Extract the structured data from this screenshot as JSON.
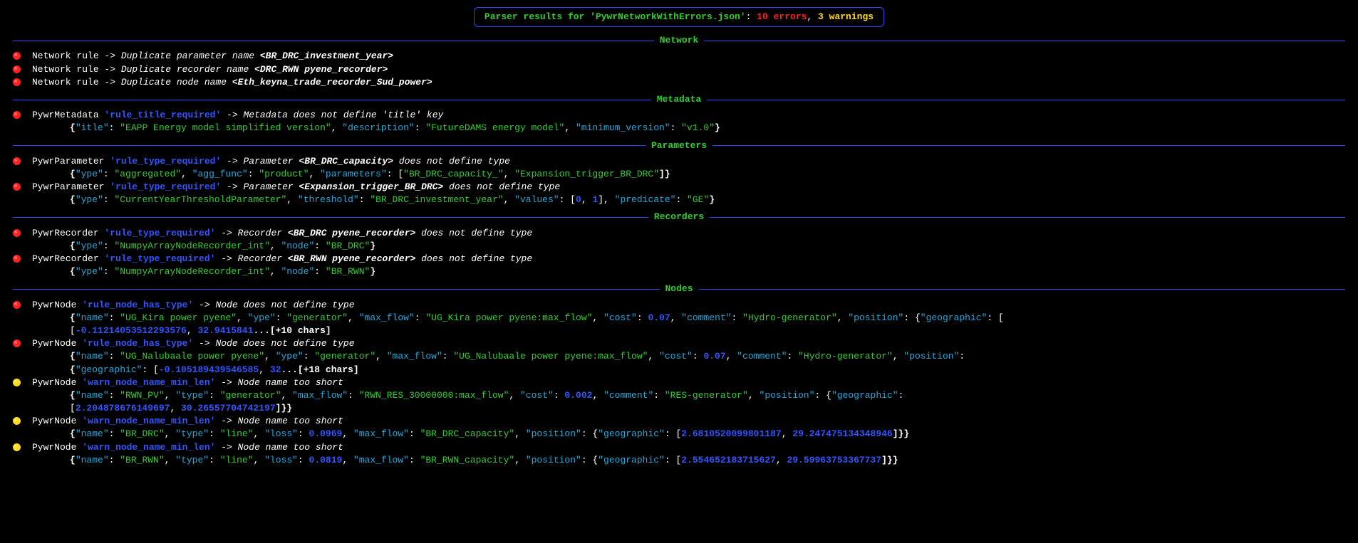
{
  "header": {
    "prefix": "Parser results for ",
    "filename": "'PywrNetworkWithErrors.json'",
    "sep1": ": ",
    "errors_count": "10",
    "errors_word": " errors",
    "sep2": ", ",
    "warnings_count": "3",
    "warnings_word": " warnings"
  },
  "sections": {
    "network": "Network",
    "metadata": "Metadata",
    "parameters": "Parameters",
    "recorders": "Recorders",
    "nodes": "Nodes"
  },
  "network": {
    "r1": {
      "a": "Network rule -> ",
      "b": "Duplicate parameter name ",
      "c": "<BR_DRC_investment_year>"
    },
    "r2": {
      "a": "Network rule -> ",
      "b": "Duplicate recorder name ",
      "c": "<DRC_RWN pyene_recorder>"
    },
    "r3": {
      "a": "Network rule -> ",
      "b": "Duplicate node name ",
      "c": "<Eth_keyna_trade_recorder_Sud_power>"
    }
  },
  "metadata": {
    "r1": {
      "a": "PywrMetadata ",
      "b": "'rule_title_required'",
      "c": " -> ",
      "d": "Metadata does not define 'title' key"
    },
    "j1_1": "{",
    "j1_2": "\"itle\"",
    "j1_3": ": ",
    "j1_4": "\"EAPP Energy model simplified version\"",
    "j1_5": ", ",
    "j1_6": "\"description\"",
    "j1_7": ": ",
    "j1_8": "\"FutureDAMS energy model\"",
    "j1_9": ", ",
    "j1_10": "\"minimum_version\"",
    "j1_11": ": ",
    "j1_12": "\"v1.0\"",
    "j1_13": "}"
  },
  "parameters": {
    "r1": {
      "a": "PywrParameter ",
      "b": "'rule_type_required'",
      "c": " -> ",
      "d": "Parameter ",
      "e": "<BR_DRC_capacity>",
      "f": " does not define type"
    },
    "j1": {
      "p1": "{",
      "p2": "\"ype\"",
      "p3": ": ",
      "p4": "\"aggregated\"",
      "p5": ", ",
      "p6": "\"agg_func\"",
      "p7": ": ",
      "p8": "\"product\"",
      "p9": ", ",
      "p10": "\"parameters\"",
      "p11": ": [",
      "p12": "\"BR_DRC_capacity_\"",
      "p13": ", ",
      "p14": "\"Expansion_trigger_BR_DRC\"",
      "p15": "]}"
    },
    "r2": {
      "a": "PywrParameter ",
      "b": "'rule_type_required'",
      "c": " -> ",
      "d": "Parameter ",
      "e": "<Expansion_trigger_BR_DRC>",
      "f": " does not define type"
    },
    "j2": {
      "p1": "{",
      "p2": "\"ype\"",
      "p3": ": ",
      "p4": "\"CurrentYearThresholdParameter\"",
      "p5": ", ",
      "p6": "\"threshold\"",
      "p7": ": ",
      "p8": "\"BR_DRC_investment_year\"",
      "p9": ", ",
      "p10": "\"values\"",
      "p11": ": [",
      "p12": "0",
      "p13": ", ",
      "p14": "1",
      "p15": "], ",
      "p16": "\"predicate\"",
      "p17": ": ",
      "p18": "\"GE\"",
      "p19": "}"
    }
  },
  "recorders": {
    "r1": {
      "a": "PywrRecorder ",
      "b": "'rule_type_required'",
      "c": " -> ",
      "d": "Recorder ",
      "e": "<BR_DRC pyene_recorder>",
      "f": " does not define type"
    },
    "j1": {
      "p1": "{",
      "p2": "\"ype\"",
      "p3": ": ",
      "p4": "\"NumpyArrayNodeRecorder_int\"",
      "p5": ", ",
      "p6": "\"node\"",
      "p7": ": ",
      "p8": "\"BR_DRC\"",
      "p9": "}"
    },
    "r2": {
      "a": "PywrRecorder ",
      "b": "'rule_type_required'",
      "c": " -> ",
      "d": "Recorder ",
      "e": "<BR_RWN pyene_recorder>",
      "f": " does not define type"
    },
    "j2": {
      "p1": "{",
      "p2": "\"ype\"",
      "p3": ": ",
      "p4": "\"NumpyArrayNodeRecorder_int\"",
      "p5": ", ",
      "p6": "\"node\"",
      "p7": ": ",
      "p8": "\"BR_RWN\"",
      "p9": "}"
    }
  },
  "nodes": {
    "r1": {
      "a": "PywrNode ",
      "b": "'rule_node_has_type'",
      "c": " -> ",
      "d": "Node does not define type"
    },
    "j1": {
      "p1": "{",
      "p2": "\"name\"",
      "p3": ": ",
      "p4": "\"UG_Kira power pyene\"",
      "p5": ", ",
      "p6": "\"ype\"",
      "p7": ": ",
      "p8": "\"generator\"",
      "p9": ", ",
      "p10": "\"max_flow\"",
      "p11": ": ",
      "p12": "\"UG_Kira power pyene:max_flow\"",
      "p13": ", ",
      "p14": "\"cost\"",
      "p15": ": ",
      "p16": "0.07",
      "p17": ", ",
      "p18": "\"comment\"",
      "p19": ": ",
      "p20": "\"Hydro-generator\"",
      "p21": ", ",
      "p22": "\"position\"",
      "p23": ": {",
      "p24": "\"geographic\"",
      "p25": ": ["
    },
    "j1b": {
      "p1": "-0.11214053512293576",
      "p2": ", ",
      "p3": "32.9415841",
      "p4": "...[+10 chars]"
    },
    "r2": {
      "a": "PywrNode ",
      "b": "'rule_node_has_type'",
      "c": " -> ",
      "d": "Node does not define type"
    },
    "j2": {
      "p1": "{",
      "p2": "\"name\"",
      "p3": ": ",
      "p4": "\"UG_Nalubaale power pyene\"",
      "p5": ", ",
      "p6": "\"ype\"",
      "p7": ": ",
      "p8": "\"generator\"",
      "p9": ", ",
      "p10": "\"max_flow\"",
      "p11": ": ",
      "p12": "\"UG_Nalubaale power pyene:max_flow\"",
      "p13": ", ",
      "p14": "\"cost\"",
      "p15": ": ",
      "p16": "0.07",
      "p17": ", ",
      "p18": "\"comment\"",
      "p19": ": ",
      "p20": "\"Hydro-generator\"",
      "p21": ", ",
      "p22": "\"position\"",
      "p23": ": "
    },
    "j2b": {
      "p1": "{",
      "p2": "\"geographic\"",
      "p3": ": [",
      "p4": "-0.105189439546585",
      "p5": ", ",
      "p6": "32",
      "p7": "...[+18 chars]"
    },
    "r3": {
      "a": "PywrNode ",
      "b": "'warn_node_name_min_len'",
      "c": " -> ",
      "d": "Node name too short"
    },
    "j3": {
      "p1": "{",
      "p2": "\"name\"",
      "p3": ": ",
      "p4": "\"RWN_PV\"",
      "p5": ", ",
      "p6": "\"type\"",
      "p7": ": ",
      "p8": "\"generator\"",
      "p9": ", ",
      "p10": "\"max_flow\"",
      "p11": ": ",
      "p12": "\"RWN_RES_30000000:max_flow\"",
      "p13": ", ",
      "p14": "\"cost\"",
      "p15": ": ",
      "p16": "0.002",
      "p17": ", ",
      "p18": "\"comment\"",
      "p19": ": ",
      "p20": "\"RES-generator\"",
      "p21": ", ",
      "p22": "\"position\"",
      "p23": ": {",
      "p24": "\"geographic\"",
      "p25": ": "
    },
    "j3b": {
      "p1": "[",
      "p2": "2.204878676149697",
      "p3": ", ",
      "p4": "30.26557704742197",
      "p5": "]}}"
    },
    "r4": {
      "a": "PywrNode ",
      "b": "'warn_node_name_min_len'",
      "c": " -> ",
      "d": "Node name too short"
    },
    "j4": {
      "p1": "{",
      "p2": "\"name\"",
      "p3": ": ",
      "p4": "\"BR_DRC\"",
      "p5": ", ",
      "p6": "\"type\"",
      "p7": ": ",
      "p8": "\"line\"",
      "p9": ", ",
      "p10": "\"loss\"",
      "p11": ": ",
      "p12": "0.0969",
      "p13": ", ",
      "p14": "\"max_flow\"",
      "p15": ": ",
      "p16": "\"BR_DRC_capacity\"",
      "p17": ", ",
      "p18": "\"position\"",
      "p19": ": {",
      "p20": "\"geographic\"",
      "p21": ": [",
      "p22": "2.6810520099801187",
      "p23": ", ",
      "p24": "29.247475134348946",
      "p25": "]}}"
    },
    "r5": {
      "a": "PywrNode ",
      "b": "'warn_node_name_min_len'",
      "c": " -> ",
      "d": "Node name too short"
    },
    "j5": {
      "p1": "{",
      "p2": "\"name\"",
      "p3": ": ",
      "p4": "\"BR_RWN\"",
      "p5": ", ",
      "p6": "\"type\"",
      "p7": ": ",
      "p8": "\"line\"",
      "p9": ", ",
      "p10": "\"loss\"",
      "p11": ": ",
      "p12": "0.0819",
      "p13": ", ",
      "p14": "\"max_flow\"",
      "p15": ": ",
      "p16": "\"BR_RWN_capacity\"",
      "p17": ", ",
      "p18": "\"position\"",
      "p19": ": {",
      "p20": "\"geographic\"",
      "p21": ": [",
      "p22": "2.554652183715627",
      "p23": ", ",
      "p24": "29.59963753367737",
      "p25": "]}}"
    }
  }
}
